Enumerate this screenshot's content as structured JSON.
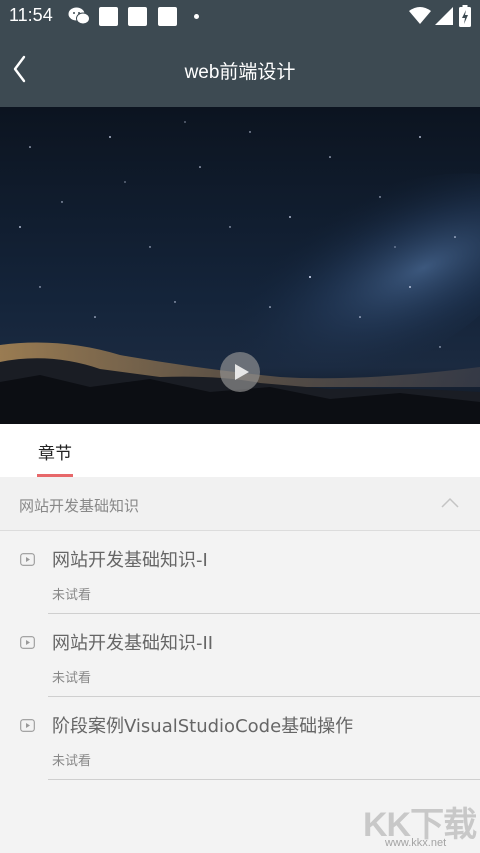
{
  "status_bar": {
    "time": "11:54"
  },
  "header": {
    "title": "web前端设计"
  },
  "tabs": [
    {
      "label": "章节"
    }
  ],
  "section": {
    "title": "网站开发基础知识",
    "lessons": [
      {
        "title": "网站开发基础知识-I",
        "status": "未试看"
      },
      {
        "title": "网站开发基础知识-II",
        "status": "未试看"
      },
      {
        "title": "阶段案例VisualStudioCode基础操作",
        "status": "未试看"
      }
    ]
  },
  "watermark": {
    "text": "KK下载",
    "url": "www.kkx.net"
  },
  "colors": {
    "header_bg": "#3d4a52",
    "accent": "#e7686a",
    "page_bg": "#f3f3f3"
  }
}
